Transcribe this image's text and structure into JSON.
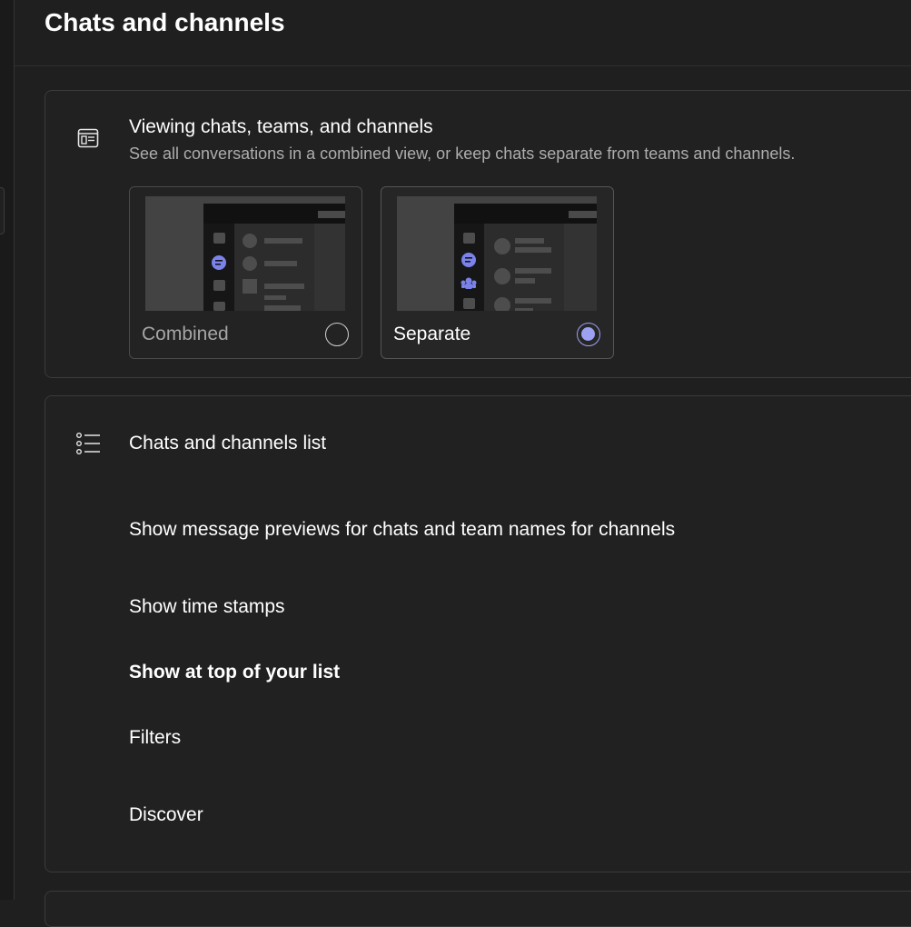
{
  "page": {
    "title": "Chats and channels"
  },
  "viewing_section": {
    "icon": "layout-icon",
    "title": "Viewing chats, teams, and channels",
    "description": "See all conversations in a combined view, or keep chats separate from teams and channels.",
    "options": [
      {
        "label": "Combined",
        "selected": false
      },
      {
        "label": "Separate",
        "selected": true
      }
    ],
    "accent_color": "#9ca1f2",
    "preview_icon_color": "#7b83eb"
  },
  "list_section": {
    "icon": "list-icon",
    "title": "Chats and channels list",
    "rows": [
      {
        "label": "Show message previews for chats and team names for channels"
      },
      {
        "label": "Show time stamps"
      },
      {
        "label": "Show at top of your list"
      },
      {
        "label": "Filters"
      },
      {
        "label": "Discover"
      }
    ]
  }
}
